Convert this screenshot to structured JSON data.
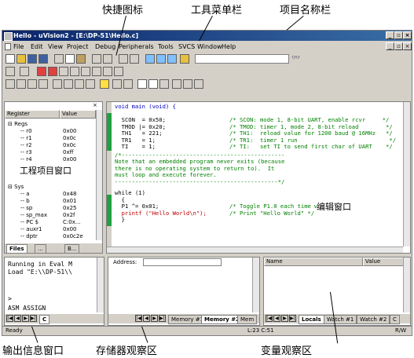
{
  "annotations": {
    "quick_icons": "快捷图标",
    "toolbar": "工具菜单栏",
    "project_name": "项目名称栏",
    "project_window": "工程项目窗口",
    "edit_window": "编辑窗口",
    "output_window": "输出信息窗口",
    "memory_window": "存储器观察区",
    "watch_window": "变量观察区"
  },
  "window": {
    "title": "Hello - uVision2 - [E:\\DP-51\\Hello.c]"
  },
  "menu": [
    "File",
    "Edit",
    "View",
    "Project",
    "Debug",
    "Peripherals",
    "Tools",
    "SVCS",
    "Window",
    "Help"
  ],
  "registers": {
    "headers": [
      "Register",
      "Value"
    ],
    "group_regs": "Regs",
    "regs": [
      {
        "name": "r0",
        "value": "0x00"
      },
      {
        "name": "r1",
        "value": "0x0c"
      },
      {
        "name": "r2",
        "value": "0x0c"
      },
      {
        "name": "r3",
        "value": "0xff"
      },
      {
        "name": "r4",
        "value": "0x00"
      }
    ],
    "group_sys": "Sys",
    "sys": [
      {
        "name": "a",
        "value": "0x48"
      },
      {
        "name": "b",
        "value": "0x01"
      },
      {
        "name": "sp",
        "value": "0x25"
      },
      {
        "name": "sp_max",
        "value": "0x2f"
      },
      {
        "name": "PC $",
        "value": "C:0x..."
      },
      {
        "name": "auxr1",
        "value": "0x00"
      },
      {
        "name": "dptr",
        "value": "0x0c2e"
      }
    ],
    "tabs": [
      "Files",
      "...",
      "B..."
    ]
  },
  "editor": {
    "lines": [
      {
        "code": "void main (void) {",
        "comment": ""
      },
      {
        "code": "",
        "comment": ""
      },
      {
        "code": "  SCON  = 0x50;",
        "comment": "/* SCON: mode 1, 8-bit UART, enable rcvr     */"
      },
      {
        "code": "  TMOD |= 0x20;",
        "comment": "/* TMOD: timer 1, mode 2, 8-bit reload        */"
      },
      {
        "code": "  TH1   = 221;",
        "comment": "/* TH1:  reload value for 1200 baud @ 16MHz   */"
      },
      {
        "code": "  TR1   = 1;",
        "comment": "/* TR1:  timer 1 run                           */"
      },
      {
        "code": "  TI    = 1;",
        "comment": "/* TI:   set TI to send first char of UART    */"
      }
    ],
    "block_comment": [
      "/*------------------------------------------------",
      "Note that an embedded program never exits (because",
      "there is no operating system to return to).  It",
      "must loop and execute forever.",
      "------------------------------------------------*/"
    ],
    "loop": [
      {
        "code": "while (1)",
        "comment": ""
      },
      {
        "code": "  {",
        "comment": ""
      },
      {
        "code": "  P1 ^= 0x01;",
        "comment": "/* Toggle P1.0 each time we print */"
      },
      {
        "code": "  printf (\"Hello World\\n\");",
        "comment": "/* Print \"Hello World\" */"
      },
      {
        "code": "  }",
        "comment": ""
      }
    ]
  },
  "output": {
    "lines": [
      "Running in Eval M",
      "Load \"E:\\\\DP-51\\\\"
    ],
    "prompt": ">",
    "command": "ASM ASSIGN"
  },
  "memory": {
    "address_label": "Address:",
    "tabs": [
      "Memory #1",
      "Memory #2",
      "Mem"
    ]
  },
  "watch": {
    "headers": [
      "Name",
      "Value"
    ],
    "tabs": [
      "Locals",
      "Watch #1",
      "Watch #2",
      "C"
    ]
  },
  "status": {
    "left": "Ready",
    "position": "L:23 C:51",
    "mode": "R/W"
  }
}
